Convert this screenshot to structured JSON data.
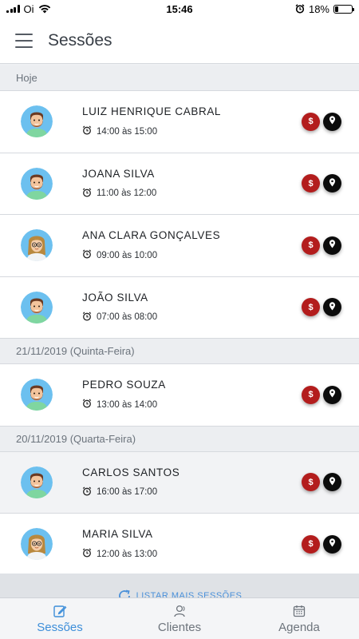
{
  "status_bar": {
    "carrier": "Oi",
    "time": "15:46",
    "battery": "18%",
    "battery_level": 0.18
  },
  "header": {
    "title": "Sessões"
  },
  "groups": [
    {
      "label": "Hoje",
      "sessions": [
        {
          "name": "LUIZ HENRIQUE CABRAL",
          "time": "14:00 às 15:00",
          "avatar": "male"
        },
        {
          "name": "JOANA SILVA",
          "time": "11:00 às 12:00",
          "avatar": "male"
        },
        {
          "name": "ANA CLARA GONÇALVES",
          "time": "09:00 às 10:00",
          "avatar": "female"
        },
        {
          "name": "JOÃO SILVA",
          "time": "07:00 às 08:00",
          "avatar": "male"
        }
      ]
    },
    {
      "label": "21/11/2019 (Quinta-Feira)",
      "sessions": [
        {
          "name": "PEDRO SOUZA",
          "time": "13:00 às 14:00",
          "avatar": "male"
        }
      ]
    },
    {
      "label": "20/11/2019 (Quarta-Feira)",
      "sessions": [
        {
          "name": "CARLOS SANTOS",
          "time": "16:00 às 17:00",
          "avatar": "male"
        },
        {
          "name": "MARIA SILVA",
          "time": "12:00 às 13:00",
          "avatar": "female"
        }
      ]
    }
  ],
  "icons": {
    "pay": "$",
    "location": "map-pin-icon",
    "clock": "alarm-clock-icon"
  },
  "load_more": {
    "label": "LISTAR MAIS SESSÕES"
  },
  "tabs": [
    {
      "label": "Sessões",
      "icon": "edit-icon",
      "active": true
    },
    {
      "label": "Clientes",
      "icon": "users-icon",
      "active": false
    },
    {
      "label": "Agenda",
      "icon": "calendar-icon",
      "active": false
    }
  ],
  "colors": {
    "accent": "#3d8ed9",
    "pay": "#b31d1d",
    "location": "#0c0c0c"
  }
}
